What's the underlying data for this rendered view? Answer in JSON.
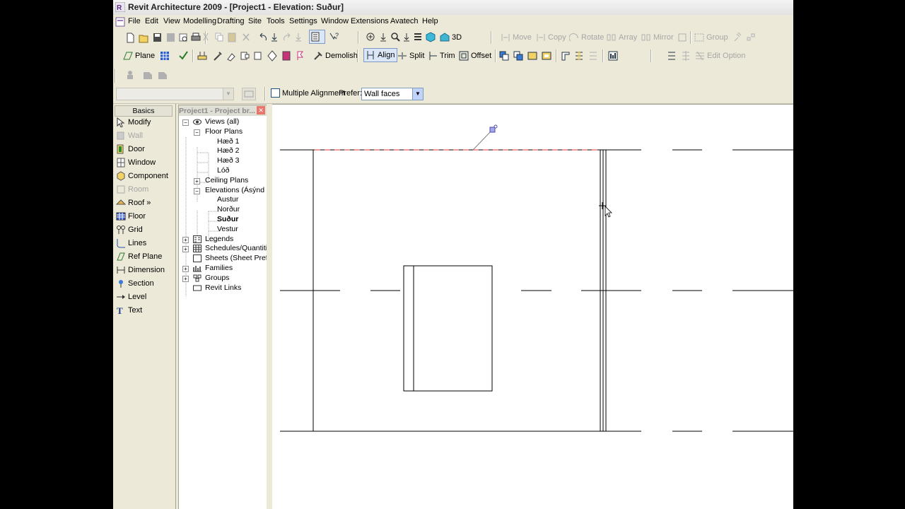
{
  "window": {
    "title": "Revit Architecture 2009 - [Project1 - Elevation: Suður]"
  },
  "menu": [
    "File",
    "Edit",
    "View",
    "Modelling",
    "Drafting",
    "Site",
    "Tools",
    "Settings",
    "Window",
    "Extensions",
    "Avatech",
    "Help"
  ],
  "toolbar1": {
    "view3d_label": "3D",
    "move_label": "Move",
    "copy_label": "Copy",
    "rotate_label": "Rotate",
    "array_label": "Array",
    "mirror_label": "Mirror",
    "group_label": "Group"
  },
  "toolbar2": {
    "plane_label": "Plane",
    "demolish_label": "Demolish",
    "align_label": "Align",
    "split_label": "Split",
    "trim_label": "Trim",
    "offset_label": "Offset",
    "edit_option_label": "Edit Option"
  },
  "options_bar": {
    "multiple_alignment_label": "Multiple Alignment",
    "multiple_alignment_checked": false,
    "prefer_label": "Prefer:",
    "prefer_value": "Wall faces"
  },
  "design_bar": {
    "tab": "Basics",
    "items": [
      {
        "label": "Modify",
        "enabled": true,
        "icon": "cursor-arrow-icon"
      },
      {
        "label": "Wall",
        "enabled": false,
        "icon": "wall-icon"
      },
      {
        "label": "Door",
        "enabled": true,
        "icon": "door-icon"
      },
      {
        "label": "Window",
        "enabled": true,
        "icon": "window-icon"
      },
      {
        "label": "Component",
        "enabled": true,
        "icon": "component-icon"
      },
      {
        "label": "Room",
        "enabled": false,
        "icon": "room-icon"
      },
      {
        "label": "Roof »",
        "enabled": true,
        "icon": "roof-icon"
      },
      {
        "label": "Floor",
        "enabled": true,
        "icon": "floor-icon"
      },
      {
        "label": "Grid",
        "enabled": true,
        "icon": "grid-icon"
      },
      {
        "label": "Lines",
        "enabled": true,
        "icon": "lines-icon"
      },
      {
        "label": "Ref Plane",
        "enabled": true,
        "icon": "ref-plane-icon"
      },
      {
        "label": "Dimension",
        "enabled": true,
        "icon": "dimension-icon"
      },
      {
        "label": "Section",
        "enabled": true,
        "icon": "section-icon"
      },
      {
        "label": "Level",
        "enabled": true,
        "icon": "level-icon"
      },
      {
        "label": "Text",
        "enabled": true,
        "icon": "text-icon"
      }
    ]
  },
  "project_browser": {
    "title": "Project1 - Project br...",
    "nodes": [
      {
        "label": "Views (all)",
        "level": 0,
        "expander": "-",
        "icon": "eye-icon"
      },
      {
        "label": "Floor Plans",
        "level": 1,
        "expander": "-"
      },
      {
        "label": "Hæð 1",
        "level": 2
      },
      {
        "label": "Hæð 2",
        "level": 2
      },
      {
        "label": "Hæð 3",
        "level": 2
      },
      {
        "label": "Lóð",
        "level": 2
      },
      {
        "label": "Ceiling Plans",
        "level": 1,
        "expander": "+"
      },
      {
        "label": "Elevations (Ásýnd u",
        "level": 1,
        "expander": "-"
      },
      {
        "label": "Austur",
        "level": 2
      },
      {
        "label": "Norður",
        "level": 2
      },
      {
        "label": "Suður",
        "level": 2,
        "bold": true
      },
      {
        "label": "Vestur",
        "level": 2
      },
      {
        "label": "Legends",
        "level": 0,
        "expander": "+",
        "icon": "legend-icon"
      },
      {
        "label": "Schedules/Quantitie",
        "level": 0,
        "expander": "+",
        "icon": "schedule-icon"
      },
      {
        "label": "Sheets (Sheet Prefix",
        "level": 0,
        "icon": "sheet-icon"
      },
      {
        "label": "Families",
        "level": 0,
        "expander": "+",
        "icon": "families-icon"
      },
      {
        "label": "Groups",
        "level": 0,
        "expander": "+",
        "icon": "groups-icon"
      },
      {
        "label": "Revit Links",
        "level": 0,
        "icon": "link-icon"
      }
    ]
  },
  "colors": {
    "chrome": "#ece9d8",
    "highlight_red": "#e0393b",
    "selection_blue": "#7e98c6"
  }
}
